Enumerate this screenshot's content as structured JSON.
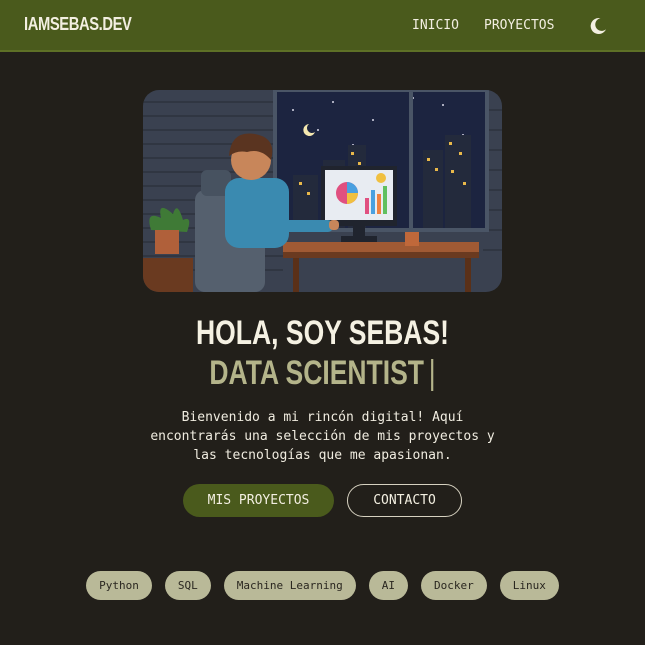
{
  "nav": {
    "brand": "IAMSEBAS.DEV",
    "links": [
      "INICIO",
      "PROYECTOS"
    ],
    "theme_icon": "moon-icon"
  },
  "hero": {
    "image": "pixel-art-developer-at-desk-night-city",
    "title": "HOLA, SOY SEBAS!",
    "subtitle": "DATA SCIENTIST",
    "cursor": "|",
    "description_lines": [
      "Bienvenido a mi rincón digital! Aquí",
      "encontrarás una selección de mis proyectos y",
      "las tecnologías que me apasionan."
    ]
  },
  "buttons": {
    "primary": "MIS PROYECTOS",
    "secondary": "CONTACTO"
  },
  "tags": [
    "Python",
    "SQL",
    "Machine Learning",
    "AI",
    "Docker",
    "Linux"
  ],
  "colors": {
    "background": "#221f1a",
    "accent": "#4a5a1c",
    "subtitle": "#b4b48a",
    "tag_bg": "#b9b998"
  }
}
